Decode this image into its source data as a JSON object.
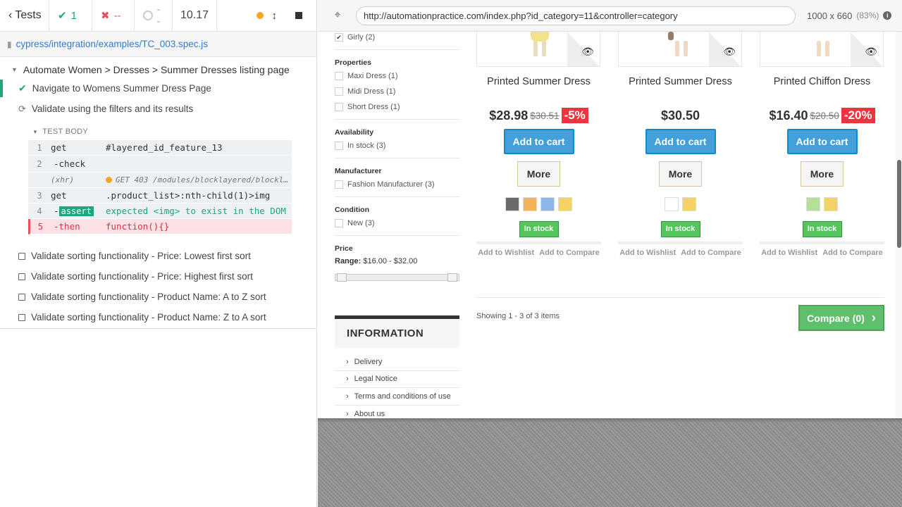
{
  "reporter": {
    "tests_label": "Tests",
    "passed": "1",
    "failed": "--",
    "pending": "--",
    "duration": "10.17",
    "spec_path": "cypress/integration/examples/TC_003.spec.js",
    "suite_title": "Automate Women > Dresses > Summer Dresses listing page",
    "tests": [
      {
        "title": "Navigate to Womens Summer Dress Page",
        "state": "passed"
      },
      {
        "title": "Validate using the filters and its results",
        "state": "running"
      }
    ],
    "test_body_label": "TEST BODY",
    "commands": [
      {
        "num": "1",
        "name": "get",
        "msg": "#layered_id_feature_13"
      },
      {
        "num": "2",
        "name": "-check",
        "msg": ""
      },
      {
        "num": "",
        "name": "(xhr)",
        "msg": "GET 403 /modules/blocklayered/blocklayered-ajax.php"
      },
      {
        "num": "3",
        "name": "get",
        "msg": ".product_list>:nth-child(1)>img"
      },
      {
        "num": "4",
        "name_prefix": "-",
        "badge": "assert",
        "msg": "expected <img> to exist in the DOM"
      },
      {
        "num": "5",
        "name": "-then",
        "msg": "function(){}"
      }
    ],
    "pending_tests": [
      "Validate sorting functionality - Price: Lowest first sort",
      "Validate sorting functionality - Price: Highest first sort",
      "Validate sorting functionality - Product Name: A to Z sort",
      "Validate sorting functionality - Product Name: Z to A sort"
    ]
  },
  "browser": {
    "url": "http://automationpractice.com/index.php?id_category=11&controller=category",
    "viewport": "1000 x 660",
    "zoom": "(83%)"
  },
  "filters": {
    "girly": "Girly (2)",
    "properties_title": "Properties",
    "properties": [
      "Maxi Dress (1)",
      "Midi Dress (1)",
      "Short Dress (1)"
    ],
    "availability_title": "Availability",
    "availability": "In stock (3)",
    "manufacturer_title": "Manufacturer",
    "manufacturer": "Fashion Manufacturer (3)",
    "condition_title": "Condition",
    "condition": "New (3)",
    "price_title": "Price",
    "range_label": "Range:",
    "range_value": " $16.00 - $32.00"
  },
  "information": {
    "title": "INFORMATION",
    "items": [
      "Delivery",
      "Legal Notice",
      "Terms and conditions of use",
      "About us"
    ]
  },
  "products": [
    {
      "name": "Printed Summer Dress",
      "price": "$28.98",
      "old_price": "$30.51",
      "discount": "-5%",
      "add_to_cart": "Add to cart",
      "more": "More",
      "stock": "In stock",
      "wishlist": "Add to Wishlist",
      "compare": "Add to Compare",
      "swatches": [
        "#6b6b6b",
        "#f2b35f",
        "#8fb6e8",
        "#f3d26a"
      ]
    },
    {
      "name": "Printed Summer Dress",
      "price": "$30.50",
      "old_price": "",
      "discount": "",
      "add_to_cart": "Add to cart",
      "more": "More",
      "stock": "In stock",
      "wishlist": "Add to Wishlist",
      "compare": "Add to Compare",
      "swatches": [
        "#ffffff",
        "#f3d26a"
      ]
    },
    {
      "name": "Printed Chiffon Dress",
      "price": "$16.40",
      "old_price": "$20.50",
      "discount": "-20%",
      "add_to_cart": "Add to cart",
      "more": "More",
      "stock": "In stock",
      "wishlist": "Add to Wishlist",
      "compare": "Add to Compare",
      "swatches": [
        "#b5e09a",
        "#f3d26a"
      ]
    }
  ],
  "listing": {
    "showing": "Showing 1 - 3 of 3 items",
    "compare_button": "Compare (0)"
  },
  "colors": {
    "pass_green": "#1ea67e",
    "fail_red": "#e94f5f",
    "cart_blue": "#43a0d8",
    "stock_green": "#55c65e",
    "discount_red": "#f13340"
  }
}
